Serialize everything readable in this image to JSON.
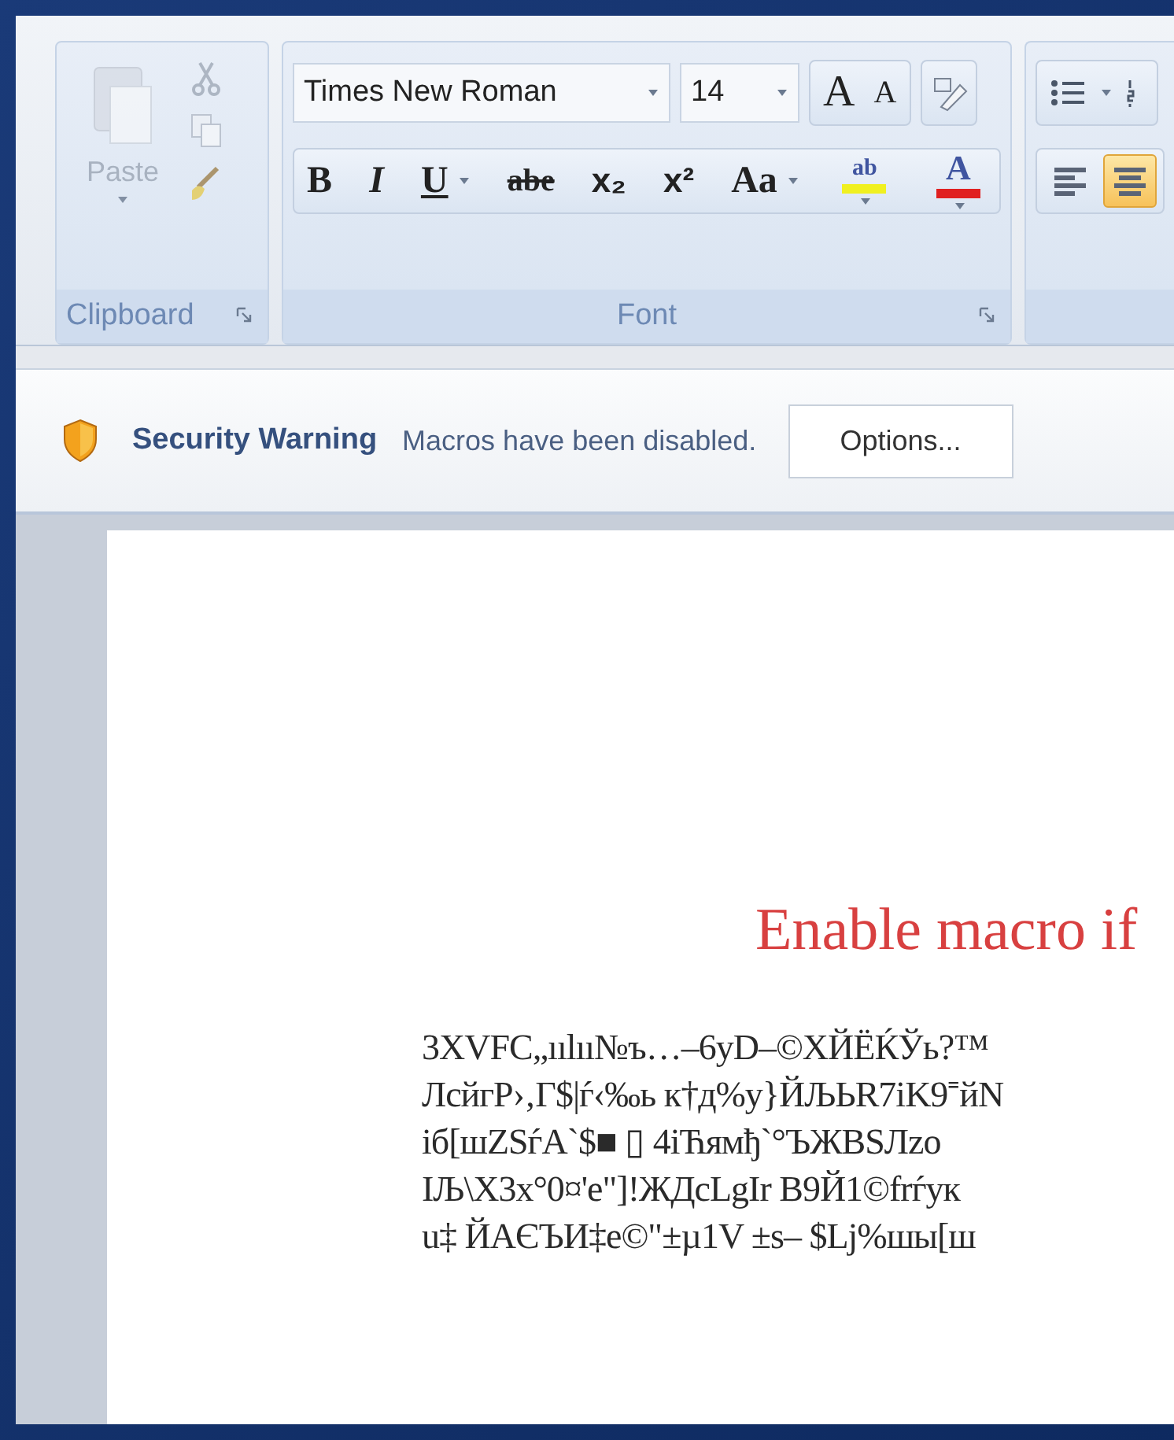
{
  "ribbon": {
    "groups": [
      {
        "kind": "clipboard",
        "label": "Clipboard",
        "paste": {
          "label": "Paste",
          "disabled": true
        }
      },
      {
        "kind": "font",
        "label": "Font",
        "font_name": "Times New Roman",
        "font_size": "14",
        "size_buttons": [
          "A",
          "A"
        ],
        "format_buttons": [
          {
            "kind": "text",
            "text": "B",
            "dropdown": false
          },
          {
            "kind": "text",
            "text": "I",
            "dropdown": false
          },
          {
            "kind": "text",
            "text": "U",
            "dropdown": true
          },
          {
            "kind": "text",
            "text": "abe",
            "dropdown": false
          },
          {
            "kind": "text",
            "text": "x₂",
            "dropdown": false
          },
          {
            "kind": "text",
            "text": "x²",
            "dropdown": false
          },
          {
            "kind": "text",
            "text": "Aa",
            "dropdown": true
          },
          {
            "kind": "color",
            "text": "ab",
            "color": "#f0f020",
            "dropdown": true
          },
          {
            "kind": "color",
            "text": "A",
            "color": "#e02020",
            "dropdown": true
          }
        ]
      },
      {
        "kind": "paragraph",
        "alignment": [
          {
            "selected": false
          },
          {
            "selected": true
          }
        ]
      }
    ]
  },
  "security_bar": {
    "title": "Security Warning",
    "message": "Macros have been disabled.",
    "button": "Options..."
  },
  "document": {
    "heading": "Enable macro if",
    "lines": [
      "3XVFC„ıılıı№ъ…–6yD–©ХЙЁЌЎь?™",
      "ЛсйгР›‚Г$|ѓ‹‰ь к†д%у}ЙЉЬR7iK9⁼йN",
      "iб[шZSѓA`$■ ▯ 4iЋямђ`°ЪЖBSЛzo",
      "IЉ\\X3x°0¤'e\"]!ЖДcLgIr  B9Й1©frѓук",
      "u‡ ЙАЄЪИ‡e©\"±µ1V  ±s– $Lj%шы[ш"
    ]
  }
}
